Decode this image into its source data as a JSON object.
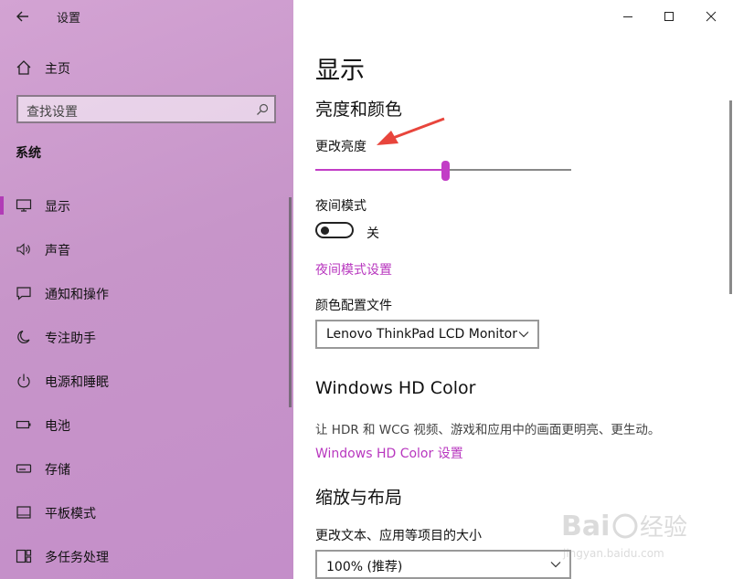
{
  "window": {
    "title": "设置"
  },
  "sidebar": {
    "home_label": "主页",
    "search_placeholder": "查找设置",
    "section_title": "系统",
    "items": [
      {
        "label": "显示",
        "icon": "monitor-icon",
        "selected": true
      },
      {
        "label": "声音",
        "icon": "speaker-icon",
        "selected": false
      },
      {
        "label": "通知和操作",
        "icon": "message-icon",
        "selected": false
      },
      {
        "label": "专注助手",
        "icon": "moon-icon",
        "selected": false
      },
      {
        "label": "电源和睡眠",
        "icon": "power-icon",
        "selected": false
      },
      {
        "label": "电池",
        "icon": "battery-icon",
        "selected": false
      },
      {
        "label": "存储",
        "icon": "storage-icon",
        "selected": false
      },
      {
        "label": "平板模式",
        "icon": "tablet-icon",
        "selected": false
      },
      {
        "label": "多任务处理",
        "icon": "multitask-icon",
        "selected": false
      }
    ]
  },
  "main": {
    "page_title": "显示",
    "brightness_section": "亮度和颜色",
    "brightness_label": "更改亮度",
    "brightness_value": 0.51,
    "night_mode_label": "夜间模式",
    "night_mode_state": "关",
    "night_mode_link": "夜间模式设置",
    "color_profile_label": "颜色配置文件",
    "color_profile_value": "Lenovo ThinkPad LCD Monitor",
    "hdr_section": "Windows HD Color",
    "hdr_description": "让 HDR 和 WCG 视频、游戏和应用中的画面更明亮、更生动。",
    "hdr_link": "Windows HD Color 设置",
    "scale_section": "缩放与布局",
    "scale_label": "更改文本、应用等项目的大小",
    "scale_value": "100% (推荐)"
  },
  "colors": {
    "accent": "#c23dc6",
    "link": "#b837bf",
    "annotation_arrow": "#e8453c"
  }
}
